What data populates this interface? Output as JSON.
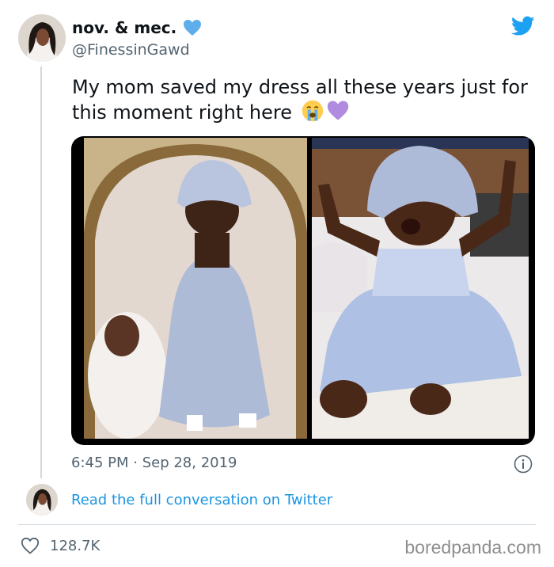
{
  "author": {
    "display_name": "nov. & mec.",
    "badge_icon": "blue-heart-icon",
    "handle": "@FinessinGawd",
    "avatar_icon": "avatar"
  },
  "brand_icon": "twitter-bird-icon",
  "tweet": {
    "text": "My mom saved my dress all these years just for this moment right here",
    "emojis": [
      "loudly-crying-face-icon",
      "purple-heart-icon"
    ]
  },
  "media": {
    "photos": [
      "photo-old-baby-dress",
      "photo-new-baby-dress"
    ]
  },
  "meta": {
    "timestamp": "6:45 PM · Sep 28, 2019",
    "info_icon": "info-icon"
  },
  "conversation_link": "Read the full conversation on Twitter",
  "engagement": {
    "like_icon": "heart-outline-icon",
    "likes": "128.7K"
  },
  "watermark": "boredpanda.com",
  "colors": {
    "link": "#1b95e0",
    "twitter_blue": "#1da1f2",
    "secondary_text": "#536471",
    "badge_blue": "#5daeea",
    "purple_heart": "#b08be0"
  }
}
